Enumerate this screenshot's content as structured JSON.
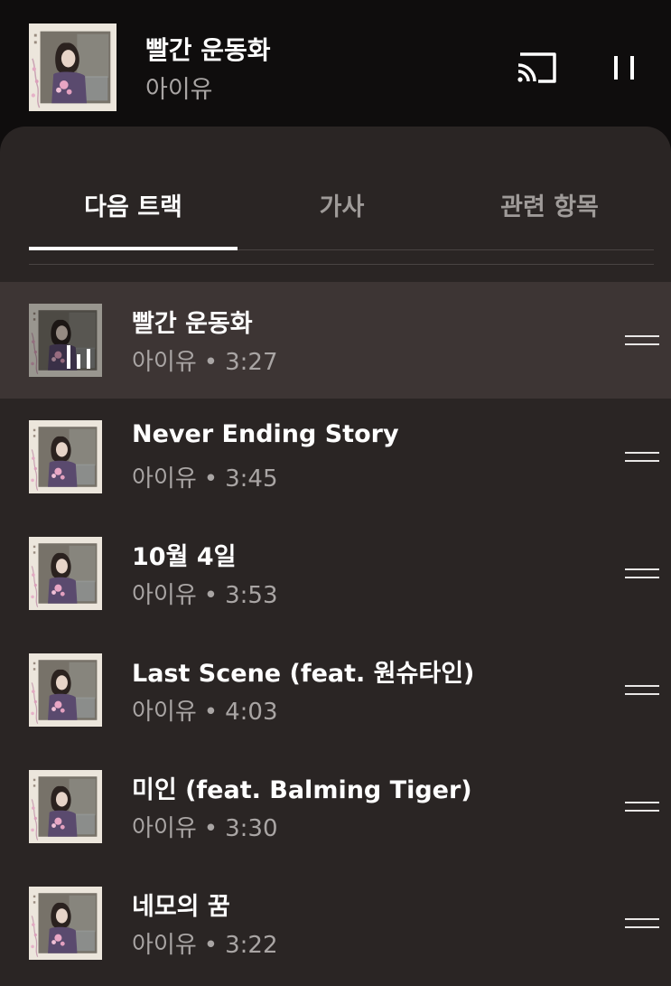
{
  "now_playing": {
    "title": "빨간 운동화",
    "artist": "아이유"
  },
  "icons": {
    "cast": "cast-icon",
    "pause": "pause-icon",
    "drag": "drag-handle-icon",
    "equalizer": "equalizer-icon"
  },
  "tabs": [
    {
      "label": "다음 트랙",
      "active": true
    },
    {
      "label": "가사",
      "active": false
    },
    {
      "label": "관련 항목",
      "active": false
    }
  ],
  "queue": [
    {
      "title": "빨간 운동화",
      "artist": "아이유",
      "separator": "•",
      "duration": "3:27",
      "playing": true
    },
    {
      "title": "Never Ending Story",
      "artist": "아이유",
      "separator": "•",
      "duration": "3:45",
      "playing": false
    },
    {
      "title": "10월 4일",
      "artist": "아이유",
      "separator": "•",
      "duration": "3:53",
      "playing": false
    },
    {
      "title": "Last Scene (feat. 원슈타인)",
      "artist": "아이유",
      "separator": "•",
      "duration": "4:03",
      "playing": false
    },
    {
      "title": "미인 (feat. Balming Tiger)",
      "artist": "아이유",
      "separator": "•",
      "duration": "3:30",
      "playing": false
    },
    {
      "title": "네모의 꿈",
      "artist": "아이유",
      "separator": "•",
      "duration": "3:22",
      "playing": false
    }
  ],
  "colors": {
    "background": "#0f0d0d",
    "sheet": "#2a2524",
    "current_row": "#3d3534",
    "secondary_text": "#a9a5a4"
  }
}
